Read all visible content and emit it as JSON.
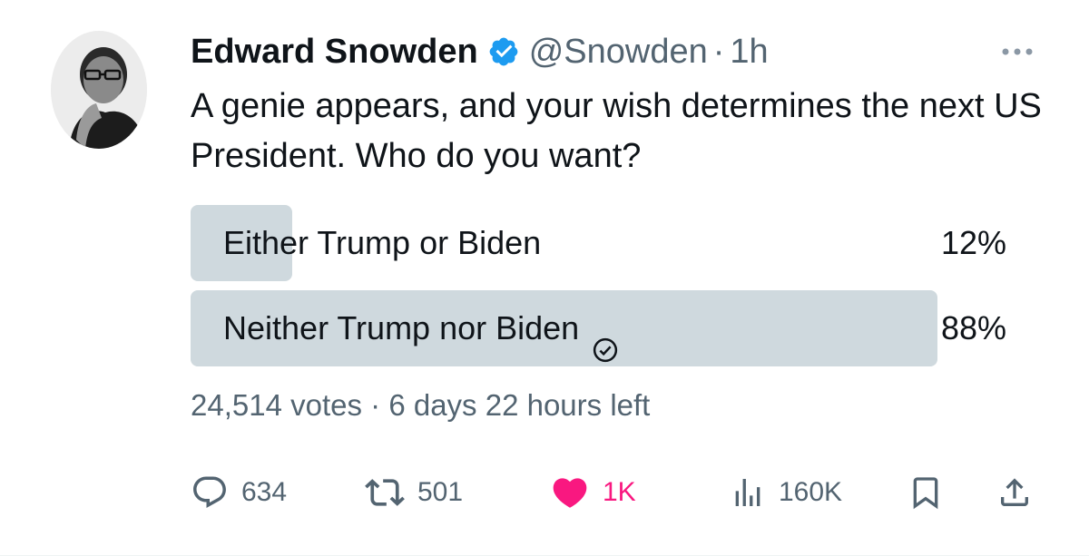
{
  "tweet": {
    "author": {
      "display_name": "Edward Snowden",
      "handle": "@Snowden",
      "verified": true,
      "avatar_icon": "user-avatar-photo"
    },
    "separator": "·",
    "time": "1h",
    "text": "A genie appears, and your wish determines the next US President. Who do you want?",
    "more_icon": "more-horizontal-icon"
  },
  "poll": {
    "options": [
      {
        "label": "Either Trump or Biden",
        "percent_text": "12%",
        "percent": 12,
        "selected": false
      },
      {
        "label": "Neither Trump nor Biden",
        "percent_text": "88%",
        "percent": 88,
        "selected": true
      }
    ],
    "votes": "24,514 votes",
    "separator": "·",
    "time_left": "6 days 22 hours left"
  },
  "actions": {
    "replies": "634",
    "retweets": "501",
    "likes": "1K",
    "views": "160K"
  },
  "colors": {
    "text": "#0f1419",
    "secondary": "#536471",
    "verified_blue": "#1d9bf0",
    "poll_bar": "#cfd9de",
    "like_pink": "#f91880"
  }
}
